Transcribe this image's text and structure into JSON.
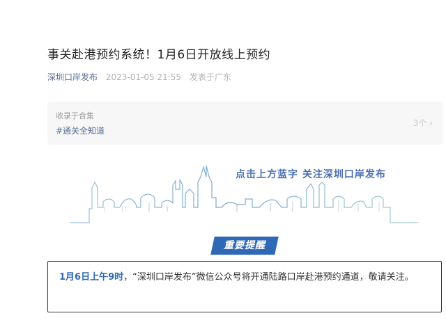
{
  "article": {
    "title": "事关赴港预约系统！1月6日开放线上预约",
    "account": "深圳口岸发布",
    "date": "2023-01-05 21:55",
    "location": "发表于广东"
  },
  "collection": {
    "label": "收录于合集",
    "tag": "#通关全知道",
    "count": "3个 ›"
  },
  "banner": {
    "follow_text": "点击上方蓝字  关注深圳口岸发布"
  },
  "reminder": {
    "label": "重要提醒"
  },
  "notice": {
    "highlight": "1月6日上午9时",
    "text": "，“深圳口岸发布”微信公众号将开通陆路口岸赴港预约通道，敬请关注。"
  },
  "colors": {
    "accent_blue": "#2f68b4",
    "link_blue": "#576b95"
  }
}
